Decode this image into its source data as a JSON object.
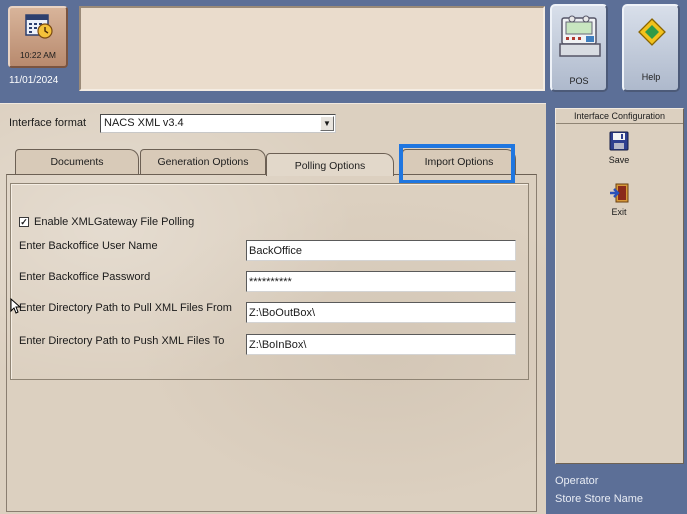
{
  "header": {
    "time": "10:22 AM",
    "date": "11/01/2024",
    "message": "",
    "pos_label": "POS",
    "help_label": "Help"
  },
  "form": {
    "format_label": "Interface format",
    "format_value": "NACS XML v3.4",
    "tabs": [
      {
        "label": "Documents"
      },
      {
        "label": "Generation Options"
      },
      {
        "label": "Polling Options"
      },
      {
        "label": "Import Options"
      }
    ],
    "enable_label": "Enable XMLGateway File Polling",
    "enable_checked": true,
    "fields": [
      {
        "label": "Enter Backoffice User Name",
        "value": "BackOffice"
      },
      {
        "label": "Enter Backoffice Password",
        "value": "**********"
      },
      {
        "label": "Enter Directory Path to Pull XML Files From",
        "value": "Z:\\BoOutBox\\"
      },
      {
        "label": "Enter Directory Path to Push XML Files To",
        "value": "Z:\\BoInBox\\"
      }
    ]
  },
  "sidebar": {
    "title": "Interface Configuration",
    "save_label": "Save",
    "exit_label": "Exit",
    "operator_label": "Operator",
    "store_label": "Store Store Name"
  },
  "colors": {
    "frame": "#5c6f97",
    "panel": "#dcd0c0",
    "highlight": "#1f76e0"
  }
}
